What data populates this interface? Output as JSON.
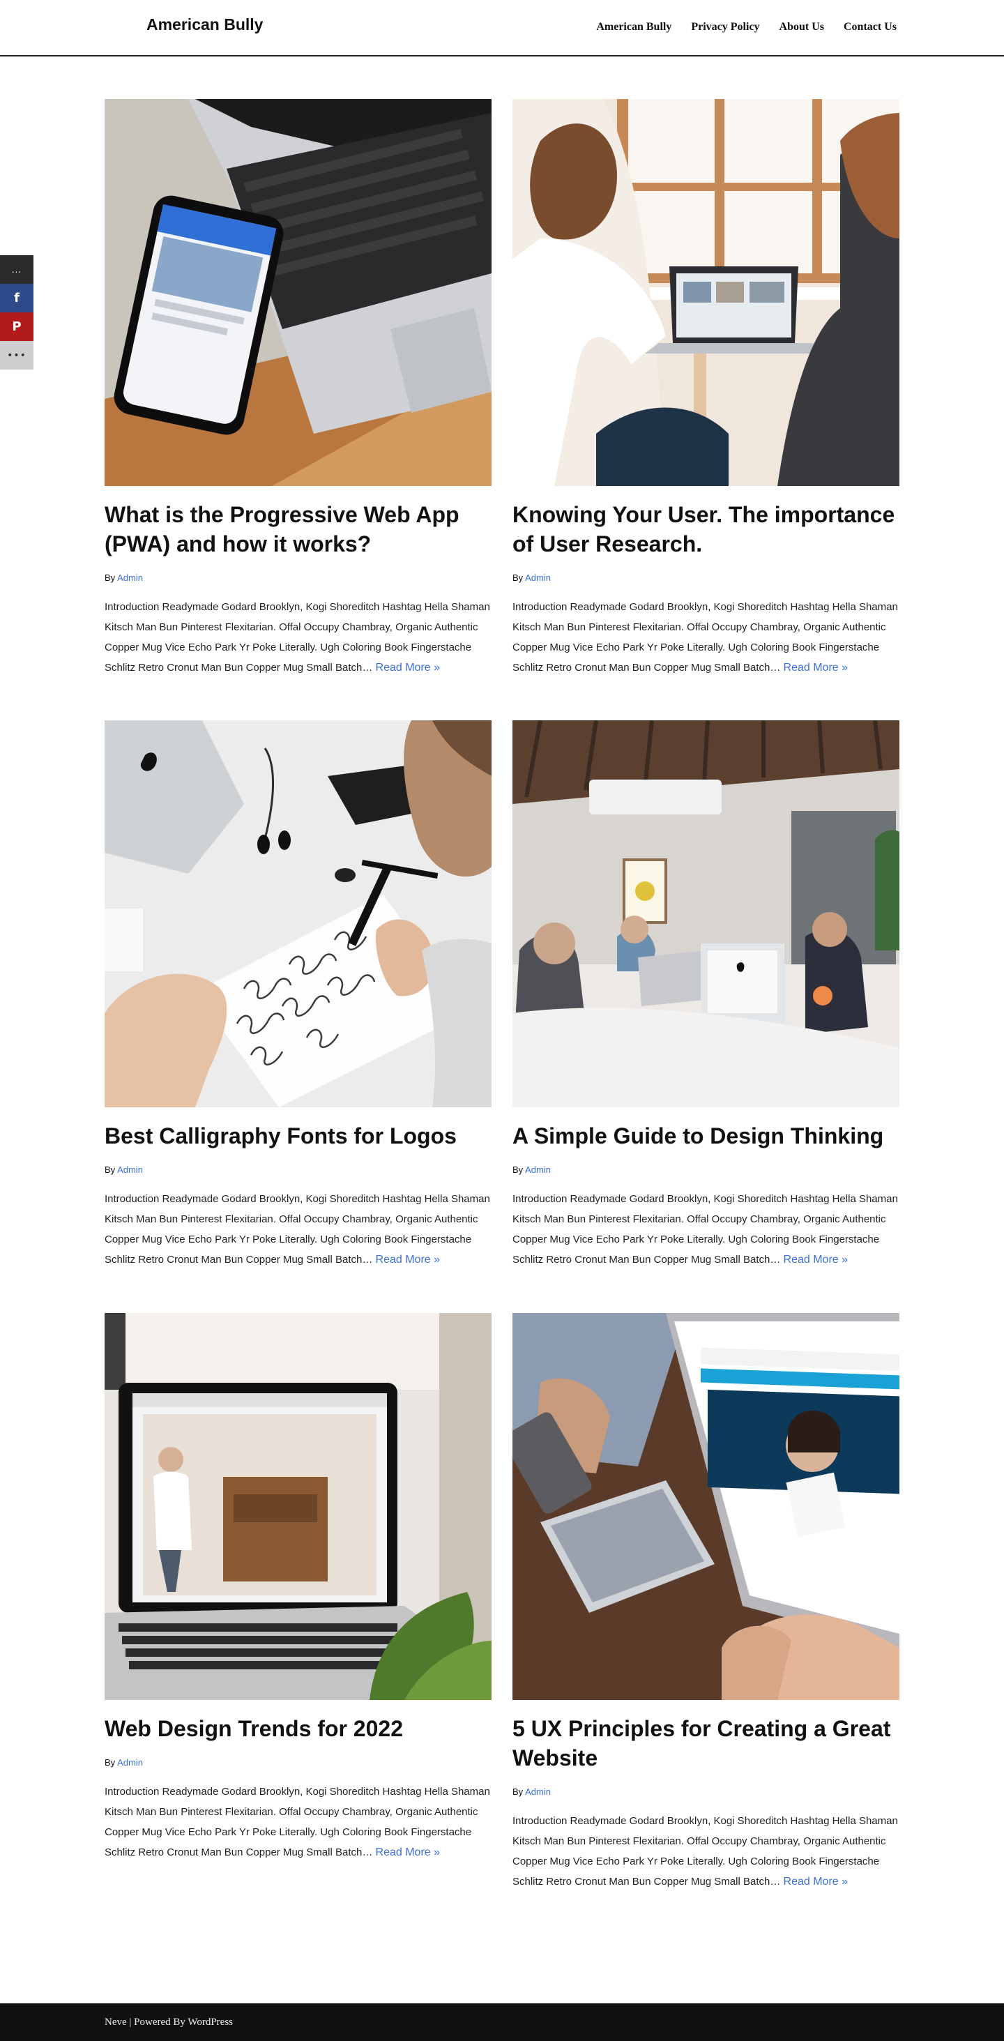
{
  "header": {
    "site_title": "American Bully",
    "nav": [
      "American Bully",
      "Privacy Policy",
      "About Us",
      "Contact Us"
    ]
  },
  "share": {
    "count": "...",
    "facebook": "f",
    "pinterest": "P",
    "more": "•••"
  },
  "posts": [
    {
      "title": "What is the Progressive Web App (PWA) and how it works?",
      "by": "By",
      "author": "Admin",
      "excerpt": "Introduction Readymade Godard Brooklyn, Kogi Shoreditch Hashtag Hella Shaman Kitsch Man Bun Pinterest Flexitarian. Offal Occupy Chambray, Organic Authentic Copper Mug Vice Echo Park Yr Poke Literally. Ugh Coloring Book Fingerstache Schlitz Retro Cronut Man Bun Copper Mug Small Batch…",
      "read_more": "Read More »"
    },
    {
      "title": "Knowing Your User. The importance of User Research.",
      "by": "By",
      "author": "Admin",
      "excerpt": "Introduction Readymade Godard Brooklyn, Kogi Shoreditch Hashtag Hella Shaman Kitsch Man Bun Pinterest Flexitarian. Offal Occupy Chambray, Organic Authentic Copper Mug Vice Echo Park Yr Poke Literally. Ugh Coloring Book Fingerstache Schlitz Retro Cronut Man Bun Copper Mug Small Batch…",
      "read_more": "Read More »"
    },
    {
      "title": "Best Calligraphy Fonts for Logos",
      "by": "By",
      "author": "Admin",
      "excerpt": "Introduction Readymade Godard Brooklyn, Kogi Shoreditch Hashtag Hella Shaman Kitsch Man Bun Pinterest Flexitarian. Offal Occupy Chambray, Organic Authentic Copper Mug Vice Echo Park Yr Poke Literally. Ugh Coloring Book Fingerstache Schlitz Retro Cronut Man Bun Copper Mug Small Batch…",
      "read_more": "Read More »"
    },
    {
      "title": "A Simple Guide to Design Thinking",
      "by": "By",
      "author": "Admin",
      "excerpt": "Introduction Readymade Godard Brooklyn, Kogi Shoreditch Hashtag Hella Shaman Kitsch Man Bun Pinterest Flexitarian. Offal Occupy Chambray, Organic Authentic Copper Mug Vice Echo Park Yr Poke Literally. Ugh Coloring Book Fingerstache Schlitz Retro Cronut Man Bun Copper Mug Small Batch…",
      "read_more": "Read More »"
    },
    {
      "title": "Web Design Trends for 2022",
      "by": "By",
      "author": "Admin",
      "excerpt": "Introduction Readymade Godard Brooklyn, Kogi Shoreditch Hashtag Hella Shaman Kitsch Man Bun Pinterest Flexitarian. Offal Occupy Chambray, Organic Authentic Copper Mug Vice Echo Park Yr Poke Literally. Ugh Coloring Book Fingerstache Schlitz Retro Cronut Man Bun Copper Mug Small Batch…",
      "read_more": "Read More »"
    },
    {
      "title": "5 UX Principles for Creating a Great Website",
      "by": "By",
      "author": "Admin",
      "excerpt": "Introduction Readymade Godard Brooklyn, Kogi Shoreditch Hashtag Hella Shaman Kitsch Man Bun Pinterest Flexitarian. Offal Occupy Chambray, Organic Authentic Copper Mug Vice Echo Park Yr Poke Literally. Ugh Coloring Book Fingerstache Schlitz Retro Cronut Man Bun Copper Mug Small Batch…",
      "read_more": "Read More »"
    }
  ],
  "footer": {
    "text": "Neve | Powered By WordPress"
  },
  "colors": {
    "link": "#3a6fd8",
    "footer_bg": "#111111",
    "facebook": "#2f4a8a",
    "pinterest": "#b31b1b"
  }
}
